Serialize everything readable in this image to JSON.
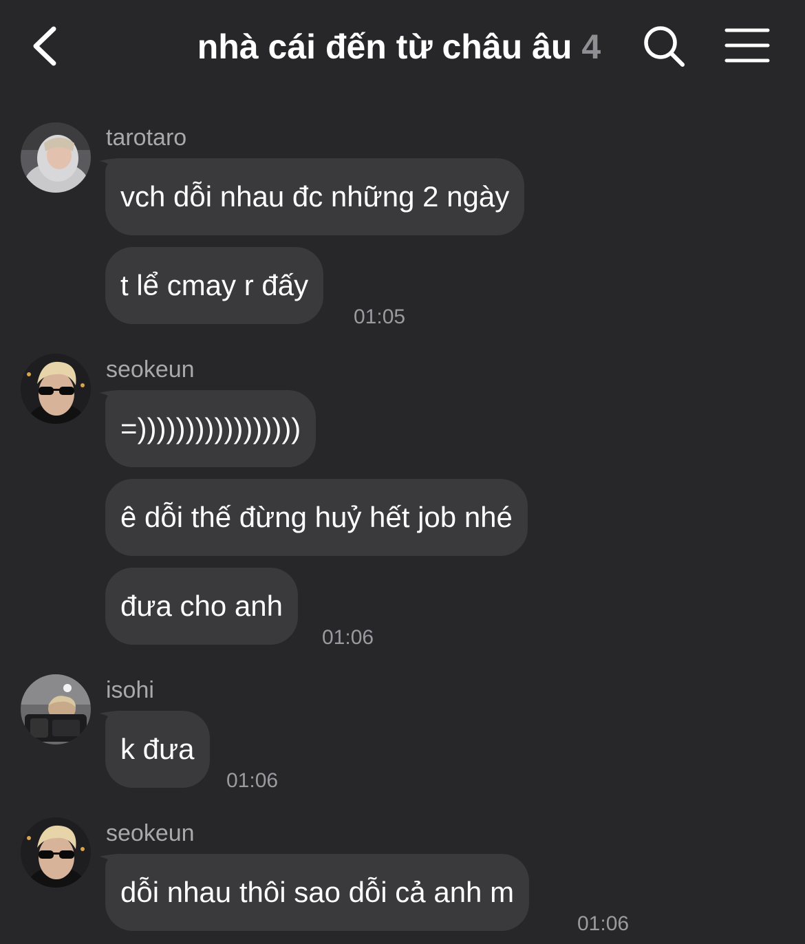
{
  "header": {
    "back_icon": "chevron-left-icon",
    "title": "nhà cái đến từ châu âu",
    "member_count": "4",
    "search_icon": "search-icon",
    "menu_icon": "hamburger-menu-icon"
  },
  "messages": [
    {
      "sender": "tarotaro",
      "bubbles": [
        "vch dỗi nhau đc những 2 ngày",
        "t lể cmay r đấy"
      ],
      "time": "01:05"
    },
    {
      "sender": "seokeun",
      "bubbles": [
        "=)))))))))))))))))",
        "ê dỗi thế đừng huỷ hết job nhé",
        "đưa cho anh"
      ],
      "time": "01:06"
    },
    {
      "sender": "isohi",
      "bubbles": [
        "k đưa"
      ],
      "time": "01:06"
    },
    {
      "sender": "seokeun",
      "bubbles": [
        "dỗi nhau thôi sao dỗi cả anh m"
      ],
      "time": "01:06"
    }
  ],
  "colors": {
    "background": "#27272a",
    "bubble": "#3a3a3d",
    "text": "#ffffff",
    "sender": "#a8a8ad",
    "timestamp": "#9a9aa0"
  }
}
